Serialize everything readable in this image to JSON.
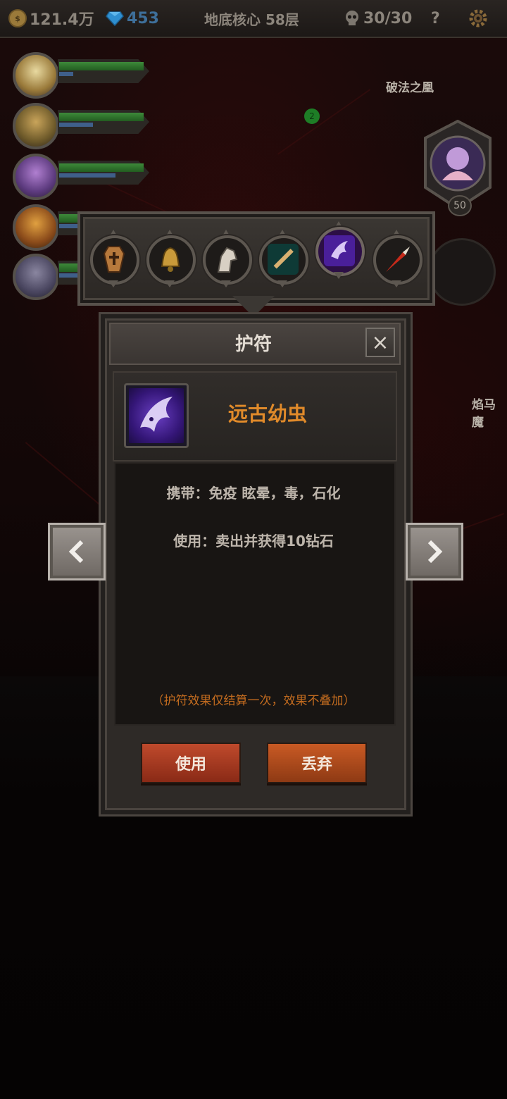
{
  "topbar": {
    "gold": "121.4万",
    "gems": "453",
    "floor": "地底核心 58层",
    "skulls": "30/30",
    "help": "?"
  },
  "map": {
    "boss_1_name": "破法之凰",
    "boss_1_level": "50",
    "boss_2_name": "焰马魔",
    "node_marker": "2"
  },
  "heroes": [
    {
      "hp": 0.72,
      "mp": 0.15
    },
    {
      "hp": 0.72,
      "mp": 0.35
    },
    {
      "hp": 0.72,
      "mp": 0.55
    },
    {
      "hp": 0.72,
      "mp": 0.3
    },
    {
      "hp": 0.72,
      "mp": 0.25
    }
  ],
  "amulets": [
    {
      "name": "coffin-icon"
    },
    {
      "name": "bell-icon"
    },
    {
      "name": "horse-head-icon"
    },
    {
      "name": "flute-icon"
    },
    {
      "name": "ancient-larva-icon",
      "selected": true
    },
    {
      "name": "feathered-spear-icon"
    }
  ],
  "dialog": {
    "title": "护符",
    "close": "×",
    "item_name": "远古幼虫",
    "carry_effect": "携带：免疫 眩晕，毒，石化",
    "use_effect": "使用：卖出并获得10钻石",
    "note": "（护符效果仅结算一次，效果不叠加）",
    "use_button": "使用",
    "discard_button": "丢弃"
  },
  "colors": {
    "item_name": "#e08a2a",
    "note": "#c46c1f",
    "use_button": "#c04a2c",
    "discard_button": "#c95a24"
  }
}
